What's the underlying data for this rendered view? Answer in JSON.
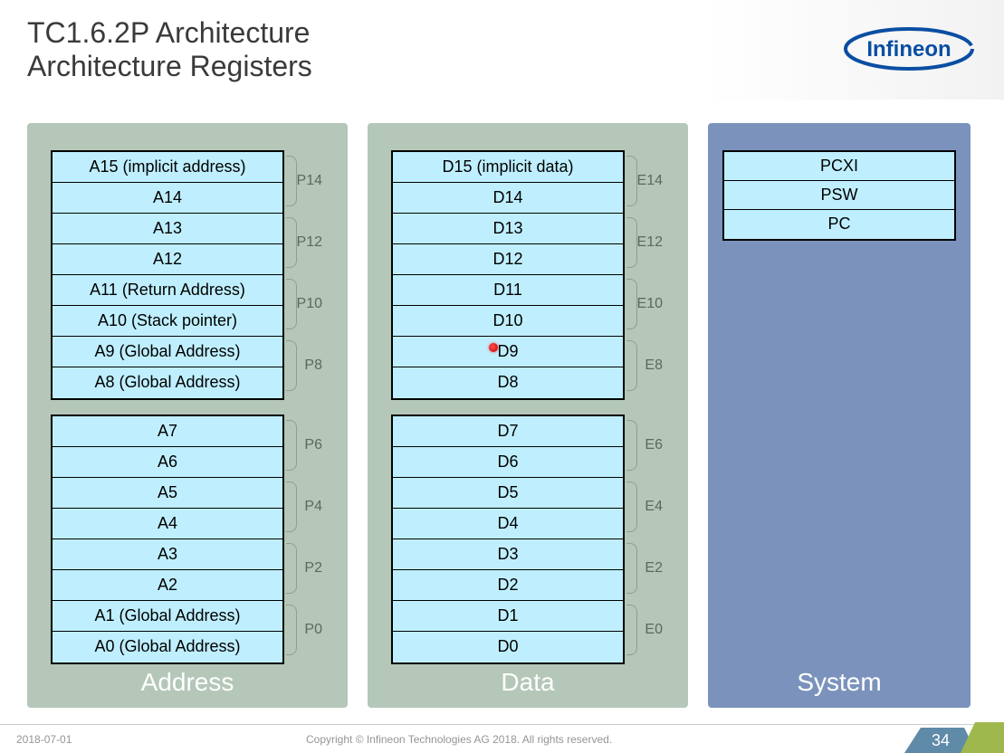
{
  "title_line1": "TC1.6.2P Architecture",
  "title_line2": "Architecture Registers",
  "brand": "Infineon",
  "panels": {
    "address": {
      "title": "Address",
      "upper": [
        {
          "pair": "P14",
          "cells": [
            "A15 (implicit address)",
            "A14"
          ]
        },
        {
          "pair": "P12",
          "cells": [
            "A13",
            "A12"
          ]
        },
        {
          "pair": "P10",
          "cells": [
            "A11  (Return Address)",
            "A10 (Stack pointer)"
          ]
        },
        {
          "pair": "P8",
          "cells": [
            "A9 (Global Address)",
            "A8 (Global Address)"
          ]
        }
      ],
      "lower": [
        {
          "pair": "P6",
          "cells": [
            "A7",
            "A6"
          ]
        },
        {
          "pair": "P4",
          "cells": [
            "A5",
            "A4"
          ]
        },
        {
          "pair": "P2",
          "cells": [
            "A3",
            "A2"
          ]
        },
        {
          "pair": "P0",
          "cells": [
            "A1 (Global Address)",
            "A0 (Global Address)"
          ]
        }
      ]
    },
    "data": {
      "title": "Data",
      "upper": [
        {
          "pair": "E14",
          "cells": [
            "D15 (implicit data)",
            "D14"
          ]
        },
        {
          "pair": "E12",
          "cells": [
            "D13",
            "D12"
          ]
        },
        {
          "pair": "E10",
          "cells": [
            "D11",
            "D10"
          ]
        },
        {
          "pair": "E8",
          "cells": [
            "D9",
            "D8"
          ]
        }
      ],
      "lower": [
        {
          "pair": "E6",
          "cells": [
            "D7",
            "D6"
          ]
        },
        {
          "pair": "E4",
          "cells": [
            "D5",
            "D4"
          ]
        },
        {
          "pair": "E2",
          "cells": [
            "D3",
            "D2"
          ]
        },
        {
          "pair": "E0",
          "cells": [
            "D1",
            "D0"
          ]
        }
      ]
    },
    "system": {
      "title": "System",
      "regs": [
        "PCXI",
        "PSW",
        "PC"
      ]
    }
  },
  "footer": {
    "date": "2018-07-01",
    "copyright": "Copyright © Infineon Technologies AG 2018. All rights reserved.",
    "page": "34"
  }
}
